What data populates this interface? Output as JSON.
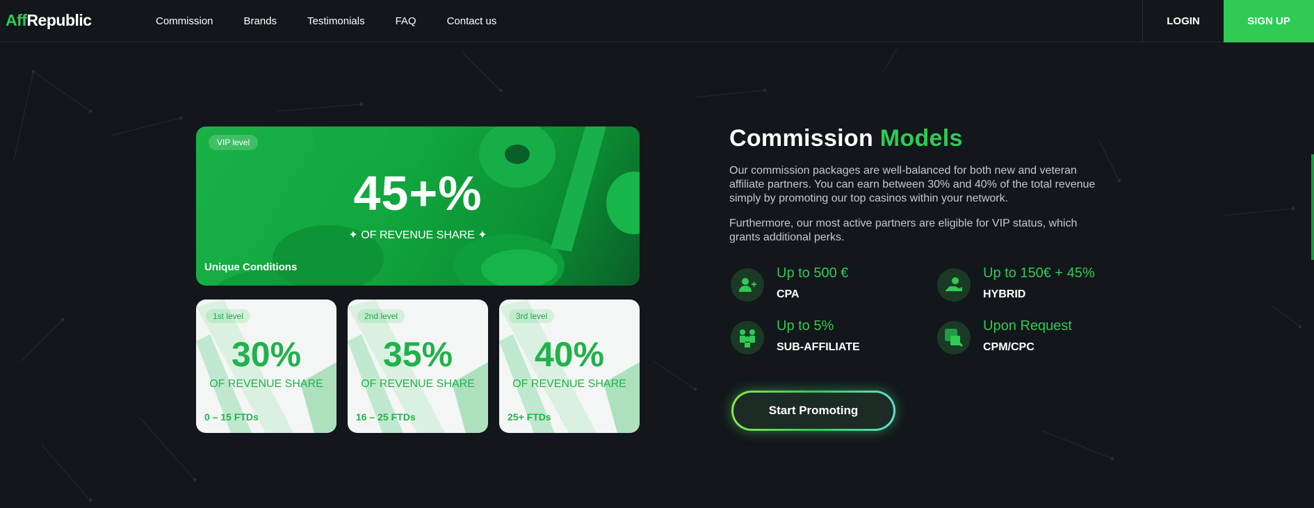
{
  "header": {
    "logo_aff": "Aff",
    "logo_republic": "Republic",
    "nav": [
      "Commission",
      "Brands",
      "Testimonials",
      "FAQ",
      "Contact us"
    ],
    "login": "LOGIN",
    "signup": "SIGN UP"
  },
  "vip": {
    "tag": "VIP level",
    "value": "45+%",
    "subtitle": "✦ OF REVENUE SHARE ✦",
    "footer": "Unique Conditions"
  },
  "levels": [
    {
      "tag": "1st level",
      "value": "30%",
      "subtitle": "OF REVENUE SHARE",
      "ftd": "0 – 15 FTDs"
    },
    {
      "tag": "2nd level",
      "value": "35%",
      "subtitle": "OF REVENUE SHARE",
      "ftd": "16 – 25 FTDs"
    },
    {
      "tag": "3rd level",
      "value": "40%",
      "subtitle": "OF REVENUE SHARE",
      "ftd": "25+ FTDs"
    }
  ],
  "section": {
    "title_white": "Commission",
    "title_green": "Models",
    "para1": "Our commission packages are well-balanced for both new and veteran affiliate partners. You can earn between 30% and 40% of the total revenue simply by promoting our top casinos within your network.",
    "para2": "Furthermore, our most active partners are eligible for VIP status, which grants additional perks."
  },
  "features": [
    {
      "value": "Up to 500 €",
      "label": "CPA",
      "icon": "add-user-icon"
    },
    {
      "value": "Up to 150€ + 45%",
      "label": "HYBRID",
      "icon": "hand-user-icon"
    },
    {
      "value": "Up to 5%",
      "label": "SUB-AFFILIATE",
      "icon": "group-icon"
    },
    {
      "value": "Upon Request",
      "label": "CPM/CPC",
      "icon": "click-icon"
    }
  ],
  "cta": "Start Promoting",
  "colors": {
    "accent": "#2fcb55",
    "background": "#13161b",
    "card_light": "#f3f6f4"
  }
}
